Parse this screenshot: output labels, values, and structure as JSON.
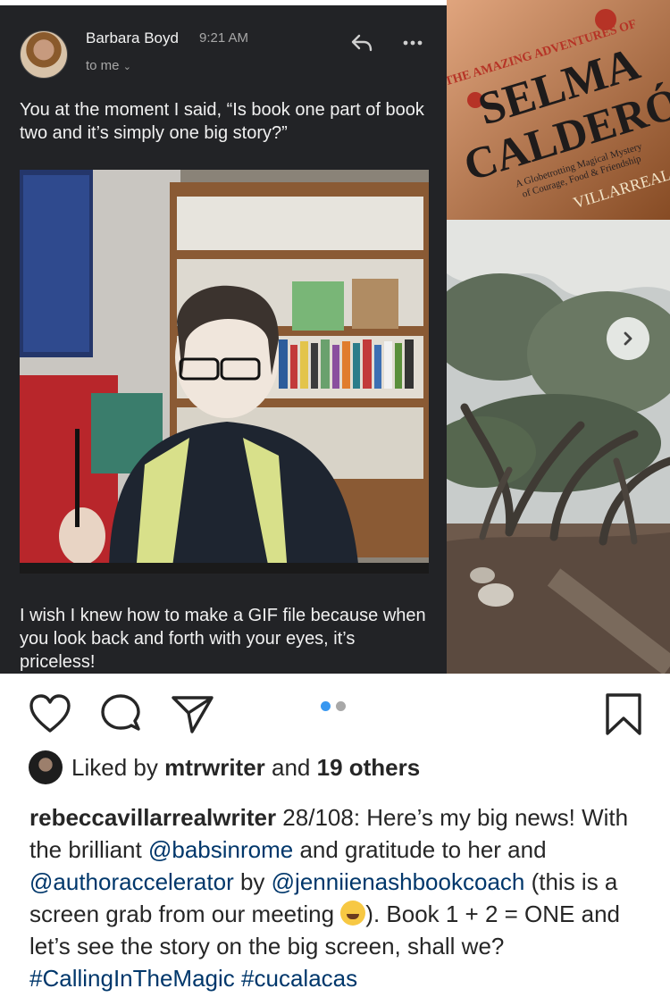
{
  "email": {
    "sender": "Barbara Boyd",
    "time": "9:21 AM",
    "to": "to me",
    "message_1": "You at the moment I said,  “Is book one part of book two and it’s simply one big story?”",
    "message_2": "I wish I knew how to make a GIF file because when you look back and forth with your eyes, it’s priceless!"
  },
  "book_cover": {
    "line_1": "THE AMAZING ADVENTURES OF",
    "title_1": "SELMA",
    "title_2": "CALDERÓN",
    "tagline_1": "A Globetrotting Magical Mystery",
    "tagline_2": "of Courage, Food & Friendship",
    "author": "VILLARREAL"
  },
  "carousel": {
    "page_count": 2,
    "active_index": 0
  },
  "likes": {
    "prefix": "Liked by ",
    "user": "mtrwriter",
    "middle": " and ",
    "others": "19 others"
  },
  "caption": {
    "username": "rebeccavillarrealwriter",
    "t1": " 28/108: Here’s my big news! With the brilliant ",
    "m1": "@babsinrome",
    "t2": " and gratitude to her and ",
    "m2": "@authoraccelerator",
    "t3": " by ",
    "m3": "@jenniienashbookcoach",
    "t4": " (this is a screen grab from our meeting ",
    "t5": "). Book 1 + 2 = ONE and let’s see the story on the big screen, shall we? ",
    "h1": "#CallingInTheMagic",
    "t6": " ",
    "h2": "#cucalacas"
  },
  "colors": {
    "email_bg": "#222326",
    "link": "#00376b",
    "dot_active": "#3897f0",
    "dot_inactive": "#a8a8a8"
  },
  "icons": [
    "heart-icon",
    "comment-icon",
    "share-icon",
    "bookmark-icon",
    "reply-icon",
    "more-icon",
    "chevron-right-icon"
  ]
}
